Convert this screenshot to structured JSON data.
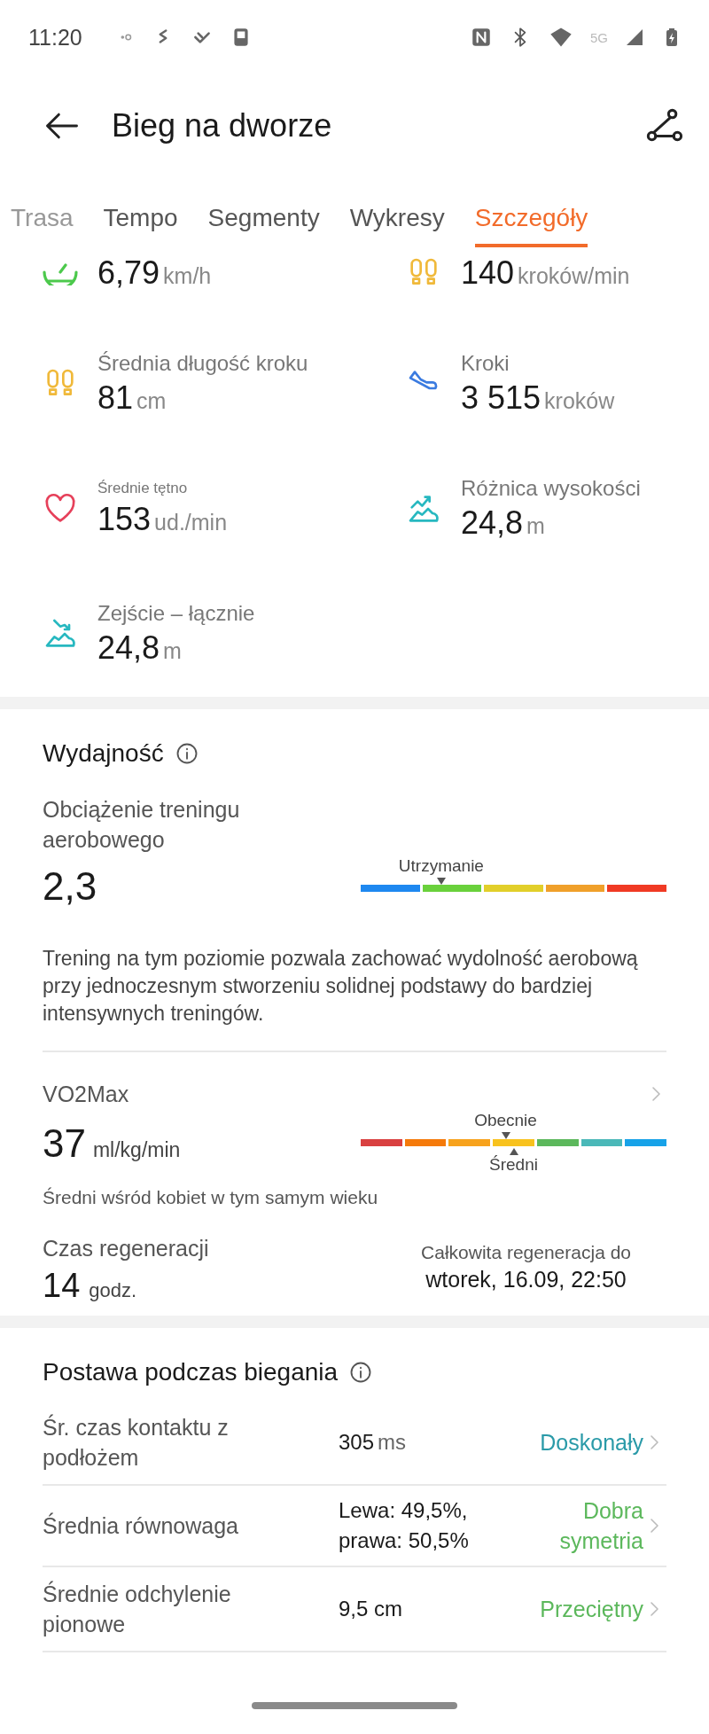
{
  "status_bar": {
    "time": "11:20",
    "network": "5G"
  },
  "header": {
    "title": "Bieg na dworze"
  },
  "tabs": [
    {
      "label": "Trasa",
      "selected": false
    },
    {
      "label": "Tempo",
      "selected": false
    },
    {
      "label": "Segmenty",
      "selected": false
    },
    {
      "label": "Wykresy",
      "selected": false
    },
    {
      "label": "Szczegóły",
      "selected": true
    }
  ],
  "stats": [
    {
      "kind": "speed",
      "value": "6,79",
      "unit": "km/h"
    },
    {
      "kind": "cadence",
      "value": "140",
      "unit": "kroków/min"
    },
    {
      "kind": "stride",
      "label": "Średnia długość kroku",
      "value": "81",
      "unit": "cm"
    },
    {
      "kind": "steps",
      "label": "Kroki",
      "value": "3 515",
      "unit": "kroków"
    },
    {
      "kind": "heart",
      "label": "Średnie tętno",
      "value": "153",
      "unit": "ud./min"
    },
    {
      "kind": "ascent",
      "label": "Różnica wysokości",
      "value": "24,8",
      "unit": "m"
    },
    {
      "kind": "descent",
      "label": "Zejście – łącznie",
      "value": "24,8",
      "unit": "m"
    }
  ],
  "performance": {
    "title": "Wydajność",
    "aerobic": {
      "label": "Obciążenie treningu aerobowego",
      "value": "2,3",
      "marker_label": "Utrzymanie",
      "segments": [
        {
          "color": "#1e88f0",
          "selected": false
        },
        {
          "color": "#6ad13c",
          "selected": true
        },
        {
          "color": "#e2cf2a",
          "selected": false
        },
        {
          "color": "#f0a02a",
          "selected": false
        },
        {
          "color": "#f03a24",
          "selected": false
        }
      ],
      "description": "Trening na tym poziomie pozwala zachować wydolność aerobową przy jednoczesnym stworzeniu solidnej podstawy do bardziej intensywnych treningów."
    },
    "vo2max": {
      "label": "VO2Max",
      "value": "37",
      "unit": "ml/kg/min",
      "current_label": "Obecnie",
      "average_label": "Średni",
      "segments": [
        {
          "color": "#d94040",
          "selected": false,
          "average": false
        },
        {
          "color": "#f57a0a",
          "selected": false,
          "average": false
        },
        {
          "color": "#f7a21c",
          "selected": false,
          "average": false
        },
        {
          "color": "#f8c21e",
          "selected": true,
          "average": true
        },
        {
          "color": "#5cb85c",
          "selected": false,
          "average": false
        },
        {
          "color": "#4ab8b8",
          "selected": false,
          "average": false
        },
        {
          "color": "#17a2e8",
          "selected": false,
          "average": false
        }
      ],
      "note": "Średni wśród kobiet w tym samym wieku"
    },
    "recovery": {
      "label": "Czas regeneracji",
      "value": "14",
      "unit": "godz.",
      "full_label": "Całkowita regeneracja do",
      "full_value": "wtorek, 16.09, 22:50"
    }
  },
  "running_form": {
    "title": "Postawa podczas biegania",
    "rows": [
      {
        "label": "Śr. czas kontaktu z podłożem",
        "value": "305",
        "unit": "ms",
        "rating": "Doskonały",
        "color": "#2a9aa8"
      },
      {
        "label": "Średnia równowaga",
        "value": "Lewa: 49,5%, prawa: 50,5%",
        "rating": "Dobra symetria",
        "color": "#5cb85c"
      },
      {
        "label": "Średnie odchylenie pionowe",
        "value": "9,5 cm",
        "rating": "Przeciętny",
        "color": "#5cb85c"
      }
    ]
  }
}
